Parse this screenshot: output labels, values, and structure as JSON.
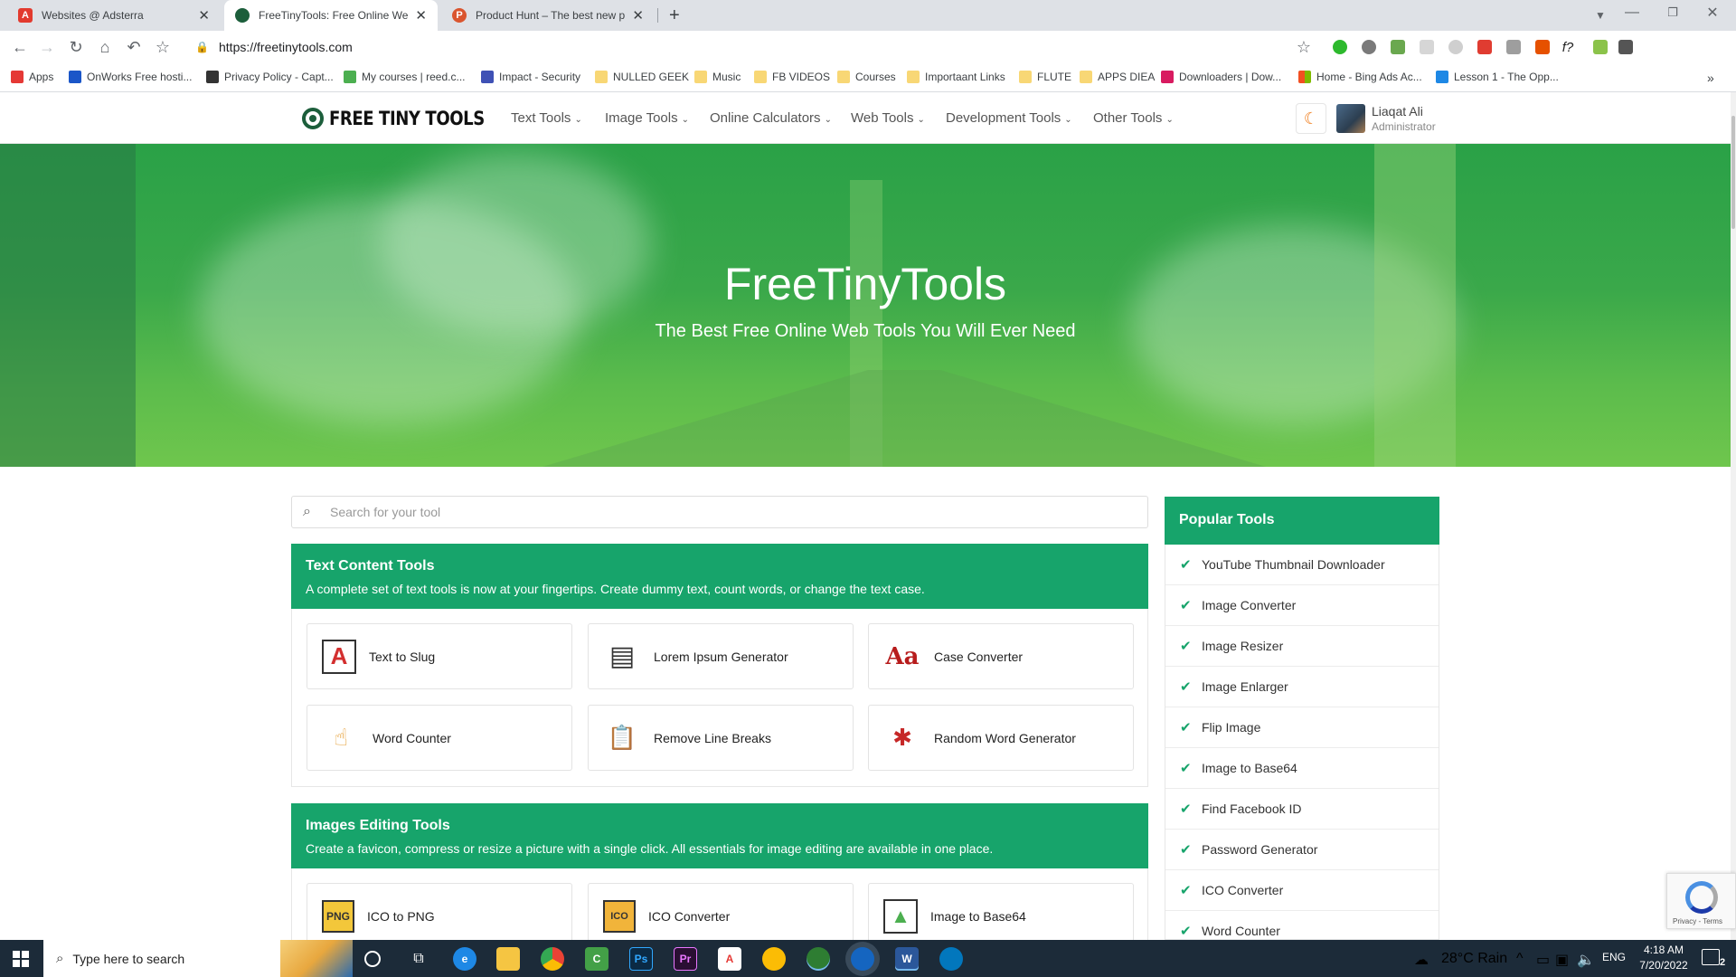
{
  "browser": {
    "tabs": [
      {
        "title": "Websites @ Adsterra",
        "favicon_color": "#e23a2e",
        "favicon_letter": "A",
        "active": false
      },
      {
        "title": "FreeTinyTools: Free Online Web T",
        "favicon_color": "#1c5e3b",
        "favicon_letter": "",
        "active": true
      },
      {
        "title": "Product Hunt – The best new pro",
        "favicon_color": "#da552f",
        "favicon_letter": "P",
        "active": false
      }
    ],
    "new_tab_label": "+",
    "url": "https://freetinytools.com",
    "bookmarks": [
      {
        "label": "Apps",
        "icon": "apps-grid-icon",
        "color": "#e53935"
      },
      {
        "label": "OnWorks Free hosti...",
        "icon": "onworks-icon",
        "color": "#1a56c8"
      },
      {
        "label": "Privacy Policy - Capt...",
        "icon": "bird-icon",
        "color": "#333333"
      },
      {
        "label": "My courses | reed.c...",
        "icon": "reed-icon",
        "color": "#4caf50"
      },
      {
        "label": "Impact - Security",
        "icon": "impact-icon",
        "color": "#3f51b5"
      },
      {
        "label": "NULLED GEEK",
        "icon": "folder-icon",
        "color": "#f8d775"
      },
      {
        "label": "Music",
        "icon": "folder-icon",
        "color": "#f8d775"
      },
      {
        "label": "FB VIDEOS",
        "icon": "folder-icon",
        "color": "#f8d775"
      },
      {
        "label": "Courses",
        "icon": "folder-icon",
        "color": "#f8d775"
      },
      {
        "label": "Importaant Links",
        "icon": "folder-icon",
        "color": "#f8d775"
      },
      {
        "label": "FLUTE",
        "icon": "folder-icon",
        "color": "#f8d775"
      },
      {
        "label": "APPS DIEA",
        "icon": "folder-icon",
        "color": "#f8d775"
      },
      {
        "label": "Downloaders | Dow...",
        "icon": "downloaders-icon",
        "color": "#d81b60"
      },
      {
        "label": "Home - Bing Ads Ac...",
        "icon": "microsoft-icon",
        "color": "#f25022"
      },
      {
        "label": "Lesson 1 - The Opp...",
        "icon": "lesson-icon",
        "color": "#1e88e5"
      }
    ],
    "more_label": "»"
  },
  "site": {
    "logo_text": "FREE TINY TOOLS",
    "menu": [
      "Text Tools",
      "Image Tools",
      "Online Calculators",
      "Web Tools",
      "Development Tools",
      "Other Tools"
    ],
    "user": {
      "name": "Liaqat Ali",
      "role": "Administrator"
    },
    "hero": {
      "title": "FreeTinyTools",
      "subtitle": "The Best Free Online Web Tools You Will Ever Need"
    },
    "search_placeholder": "Search for your tool",
    "sections": [
      {
        "title": "Text Content Tools",
        "description": "A complete set of text tools is now at your fingertips. Create dummy text, count words, or change the text case.",
        "tools": [
          "Text to Slug",
          "Lorem Ipsum Generator",
          "Case Converter",
          "Word Counter",
          "Remove Line Breaks",
          "Random Word Generator"
        ]
      },
      {
        "title": "Images Editing Tools",
        "description": "Create a favicon, compress or resize a picture with a single click. All essentials for image editing are available in one place.",
        "tools": [
          "ICO to PNG",
          "ICO Converter",
          "Image to Base64"
        ]
      }
    ],
    "popular": {
      "title": "Popular Tools",
      "items": [
        "YouTube Thumbnail Downloader",
        "Image Converter",
        "Image Resizer",
        "Image Enlarger",
        "Flip Image",
        "Image to Base64",
        "Find Facebook ID",
        "Password Generator",
        "ICO Converter",
        "Word Counter"
      ]
    },
    "recaptcha_text": "Privacy - Terms",
    "accent_color": "#17a46b"
  },
  "taskbar": {
    "search_placeholder": "Type here to search",
    "weather": "28°C  Rain",
    "language": "ENG",
    "time": "4:18 AM",
    "date": "7/20/2022",
    "notification_count": "2"
  }
}
